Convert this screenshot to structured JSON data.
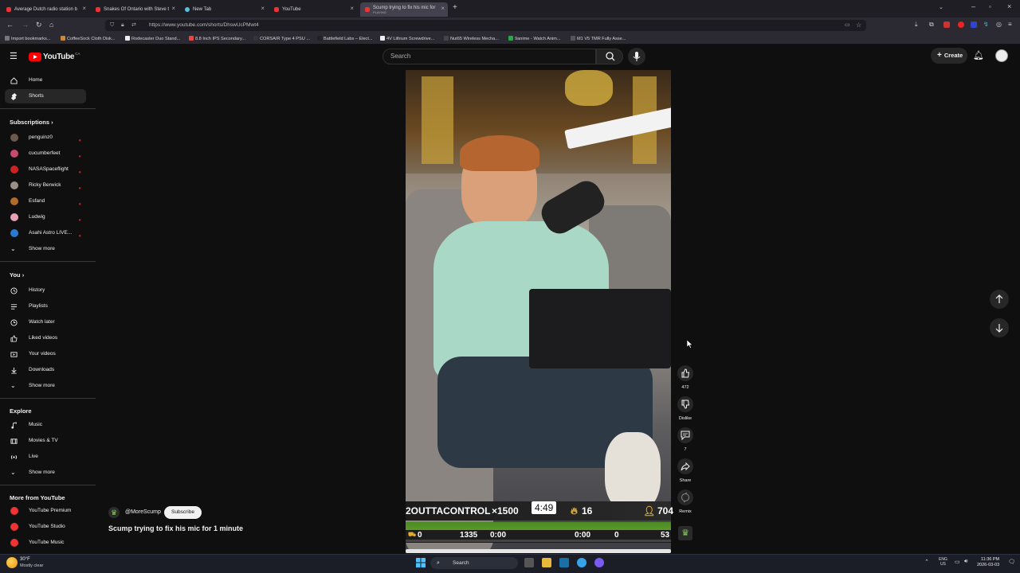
{
  "browser": {
    "tabs": [
      {
        "label": "Average Dutch radio station b"
      },
      {
        "label": "Snakes Of Ontario with Steve t"
      },
      {
        "label": "New Tab"
      },
      {
        "label": "YouTube"
      },
      {
        "label": "Scump trying to fix his mic for",
        "sublabel": "PLAYING"
      }
    ],
    "url": "https://www.youtube.com/shorts/DhswUcPMwt4",
    "bookmarks": [
      "Import bookmarks...",
      "CoffeeSock Cloth Disk...",
      "Rodecaster Duo Stand...",
      "8.8 Inch IPS Secondary...",
      "CORSAIR Type 4 PSU ...",
      "Battlefield Labs – Elect...",
      "4V Lithium Screwdrive...",
      "Nut65 Wireless Mecha...",
      "9anime - Watch Anim...",
      "M1 V5 TMR Fully Asse..."
    ]
  },
  "youtube": {
    "logo_text": "YouTube",
    "logo_region": "CA",
    "search_placeholder": "Search",
    "create_label": "Create"
  },
  "sidebar": {
    "main": [
      {
        "label": "Home",
        "icon": "home-icon"
      },
      {
        "label": "Shorts",
        "icon": "shorts-icon",
        "active": true
      }
    ],
    "subscriptions_heading": "Subscriptions",
    "subscriptions": [
      {
        "label": "penguinz0",
        "color": "#6b5a4a"
      },
      {
        "label": "cucumberfeet",
        "color": "#c94a6a"
      },
      {
        "label": "NASASpaceflight",
        "color": "#cc2222"
      },
      {
        "label": "Ricky Berwick",
        "color": "#9a8e86"
      },
      {
        "label": "Esfand",
        "color": "#b06a2a"
      },
      {
        "label": "Ludwig",
        "color": "#e8a0b4"
      },
      {
        "label": "Asahi Astro LIVE...",
        "color": "#2a7bd0"
      }
    ],
    "show_more_1": "Show more",
    "you_heading": "You",
    "you_items": [
      {
        "label": "History",
        "icon": "history-icon"
      },
      {
        "label": "Playlists",
        "icon": "playlists-icon"
      },
      {
        "label": "Watch later",
        "icon": "watch-later-icon"
      },
      {
        "label": "Liked videos",
        "icon": "like-icon"
      },
      {
        "label": "Your videos",
        "icon": "your-videos-icon"
      },
      {
        "label": "Downloads",
        "icon": "download-icon"
      }
    ],
    "show_more_2": "Show more",
    "explore_heading": "Explore",
    "explore_items": [
      {
        "label": "Music",
        "icon": "music-icon"
      },
      {
        "label": "Movies & TV",
        "icon": "movies-icon"
      },
      {
        "label": "Live",
        "icon": "live-icon"
      }
    ],
    "show_more_3": "Show more",
    "more_heading": "More from YouTube",
    "more_items": [
      {
        "label": "YouTube Premium"
      },
      {
        "label": "YouTube Studio"
      },
      {
        "label": "YouTube Music"
      }
    ]
  },
  "short": {
    "channel": "@MoreScump",
    "subscribe_label": "Subscribe",
    "title": "Scump trying to fix his mic for 1 minute",
    "overlay": {
      "team": "2OUTTACONTROL",
      "multiplier": "×1500",
      "timer": "4:49",
      "flames": "16",
      "viewers": "704",
      "sub_left": "0",
      "sub_count": "1335",
      "time_left": "0:00",
      "time_right": "0:00",
      "sub_right": "0",
      "right_num": "53"
    },
    "actions": {
      "likes": "472",
      "dislike_label": "Dislike",
      "comments": "7",
      "share_label": "Share",
      "remix_label": "Remix"
    }
  },
  "taskbar": {
    "weather_temp": "30°F",
    "weather_desc": "Mostly clear",
    "search_label": "Search",
    "lang_top": "ENG",
    "lang_bottom": "US",
    "time": "11:36 PM",
    "date": "2026-03-03"
  }
}
